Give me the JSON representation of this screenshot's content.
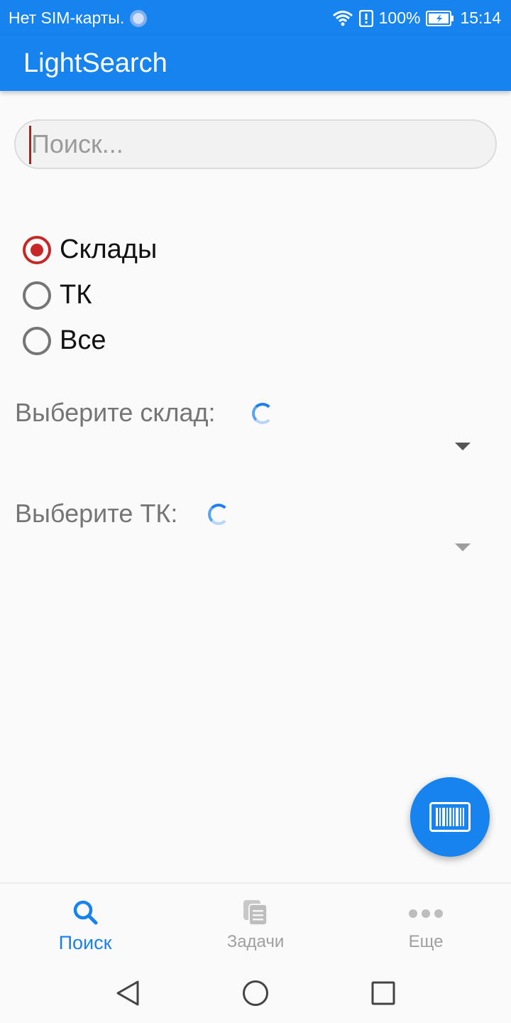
{
  "status_bar": {
    "carrier": "Нет SIM-карты.",
    "battery": "100%",
    "time": "15:14"
  },
  "app_bar": {
    "title": "LightSearch"
  },
  "search": {
    "placeholder": "Поиск...",
    "value": ""
  },
  "radio_group": {
    "options": [
      {
        "label": "Склады",
        "checked": true
      },
      {
        "label": "ТК",
        "checked": false
      },
      {
        "label": "Все",
        "checked": false
      }
    ]
  },
  "selectors": {
    "warehouse": {
      "label": "Выберите склад:",
      "loading": true
    },
    "tk": {
      "label": "Выберите ТК:",
      "loading": true
    }
  },
  "fab": {
    "icon": "barcode-icon"
  },
  "bottom_nav": {
    "items": [
      {
        "label": "Поиск",
        "icon": "search-icon",
        "active": true
      },
      {
        "label": "Задачи",
        "icon": "tasks-icon",
        "active": false
      },
      {
        "label": "Еще",
        "icon": "more-icon",
        "active": false
      }
    ]
  },
  "colors": {
    "primary": "#1683ee",
    "accent": "#c62828",
    "text_secondary": "#757575"
  }
}
